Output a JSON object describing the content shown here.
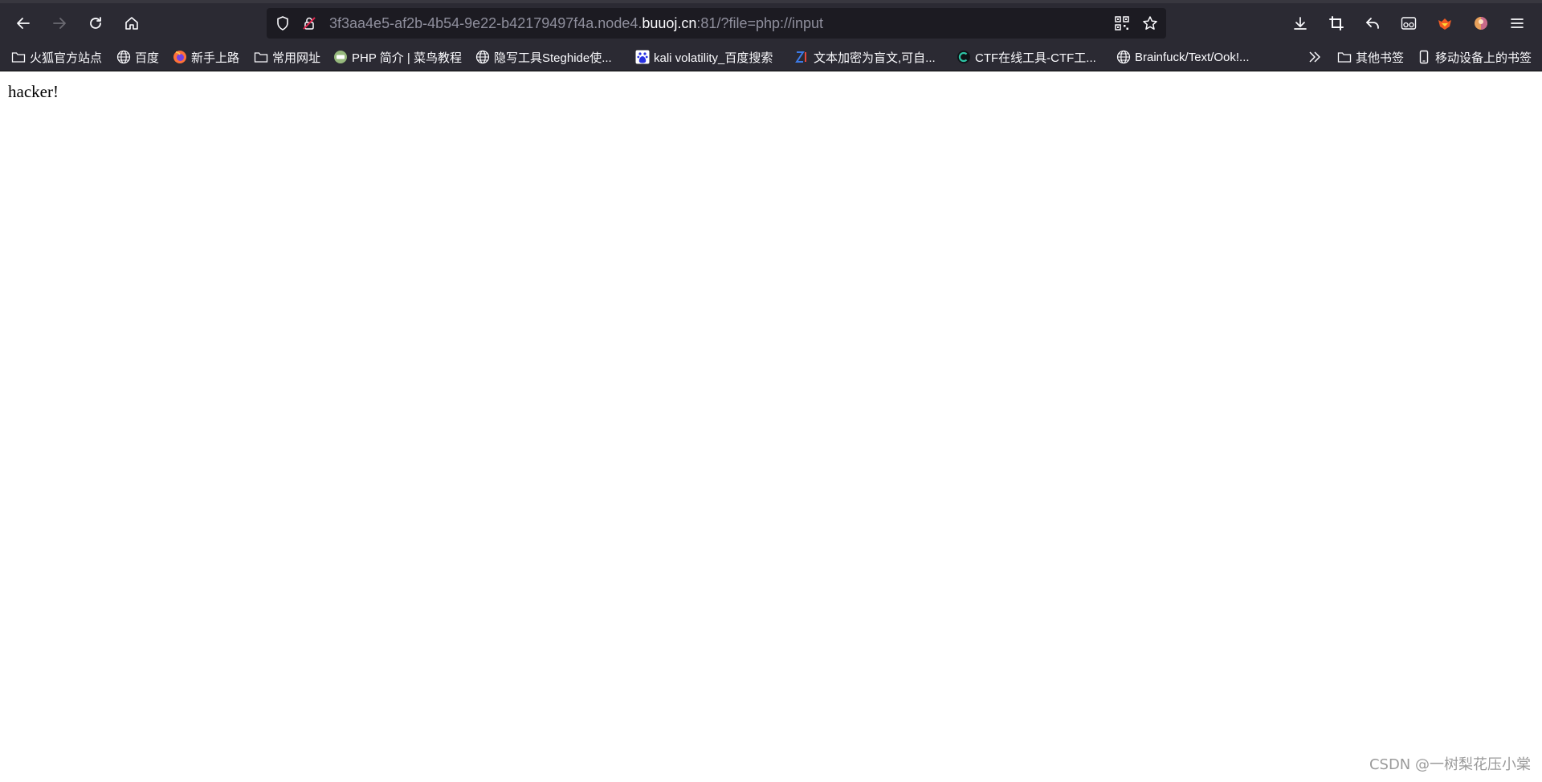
{
  "browser": {
    "url_host_prefix": "3f3aa4e5-af2b-4b54-9e22-b42179497f4a.node4.",
    "url_host": "buuoj.cn",
    "url_suffix": ":81/?file=php://input"
  },
  "bookmarks": [
    {
      "label": "火狐官方站点",
      "icon": "folder-icon"
    },
    {
      "label": "百度",
      "icon": "globe-icon"
    },
    {
      "label": "新手上路",
      "icon": "firefox-icon"
    },
    {
      "label": "常用网址",
      "icon": "folder-icon"
    },
    {
      "label": "PHP 简介 | 菜鸟教程",
      "icon": "runoob-icon"
    },
    {
      "label": "隐写工具Steghide使...",
      "icon": "globe-icon"
    },
    {
      "label": "kali volatility_百度搜索",
      "icon": "baidu-paw-icon"
    },
    {
      "label": "文本加密为盲文,可自...",
      "icon": "zi-icon"
    },
    {
      "label": "CTF在线工具-CTF工...",
      "icon": "ctf-icon"
    },
    {
      "label": "Brainfuck/Text/Ook!...",
      "icon": "globe-icon"
    }
  ],
  "bookmarks_right": [
    {
      "label": "其他书签",
      "icon": "folder-icon"
    },
    {
      "label": "移动设备上的书签",
      "icon": "mobile-icon"
    }
  ],
  "page": {
    "text": "hacker!"
  },
  "watermark": "CSDN @一树梨花压小棠",
  "colors": {
    "toolbar_bg": "#2b2a33",
    "urlbar_bg": "#1c1b22",
    "text_light": "#fbfbfe",
    "text_dim": "#8f8f9d"
  }
}
